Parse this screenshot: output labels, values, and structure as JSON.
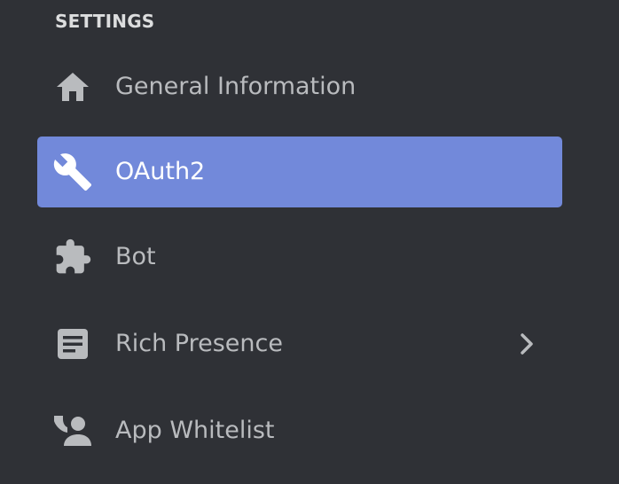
{
  "settings": {
    "header": "SETTINGS",
    "items": [
      {
        "label": "General Information",
        "icon": "home-icon",
        "selected": false
      },
      {
        "label": "OAuth2",
        "icon": "wrench-icon",
        "selected": true
      },
      {
        "label": "Bot",
        "icon": "puzzle-icon",
        "selected": false
      },
      {
        "label": "Rich Presence",
        "icon": "document-icon",
        "selected": false,
        "has_submenu": true
      },
      {
        "label": "App Whitelist",
        "icon": "user-card-icon",
        "selected": false
      }
    ]
  },
  "colors": {
    "background": "#2f3136",
    "selected_background": "#7289da",
    "text": "#b9bbbe",
    "selected_text": "#ffffff",
    "icon": "#b9bbbe",
    "header": "#dcddde"
  }
}
